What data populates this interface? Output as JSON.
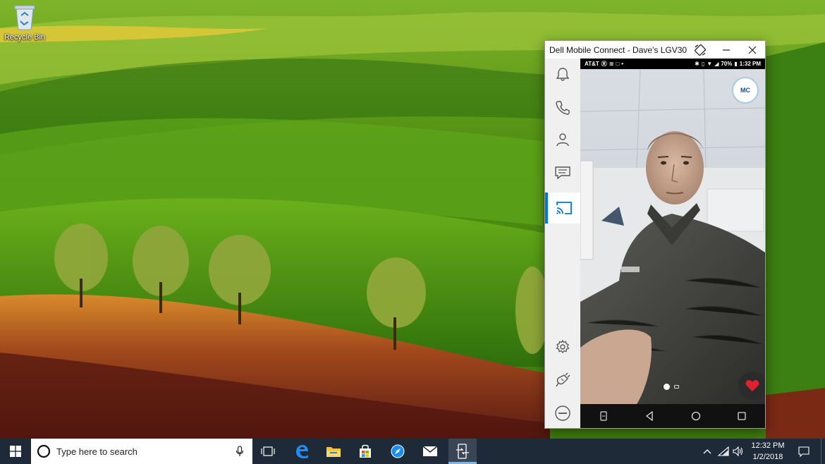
{
  "desktop": {
    "recycle_bin_label": "Recycle Bin"
  },
  "window": {
    "title": "Dell Mobile Connect - Dave's LGV30",
    "sidebar_items": [
      {
        "name": "notifications",
        "icon": "bell-icon"
      },
      {
        "name": "calls",
        "icon": "phone-icon"
      },
      {
        "name": "contacts",
        "icon": "person-icon"
      },
      {
        "name": "messages",
        "icon": "message-icon"
      },
      {
        "name": "mirror",
        "icon": "cast-icon",
        "active": true
      },
      {
        "name": "settings",
        "icon": "gear-icon"
      },
      {
        "name": "connection",
        "icon": "plug-icon"
      },
      {
        "name": "disconnect",
        "icon": "minus-circle-icon"
      }
    ],
    "accent_color": "#0078d7"
  },
  "phone": {
    "carrier": "AT&T",
    "battery": "70%",
    "time": "1:32 PM",
    "badge": "MC"
  },
  "taskbar": {
    "search_placeholder": "Type here to search",
    "time": "12:32 PM",
    "date": "1/2/2018",
    "apps": [
      "task-view-icon",
      "edge-icon",
      "file-explorer-icon",
      "store-icon",
      "safari-icon",
      "mail-icon",
      "dell-mobile-connect-icon"
    ]
  }
}
